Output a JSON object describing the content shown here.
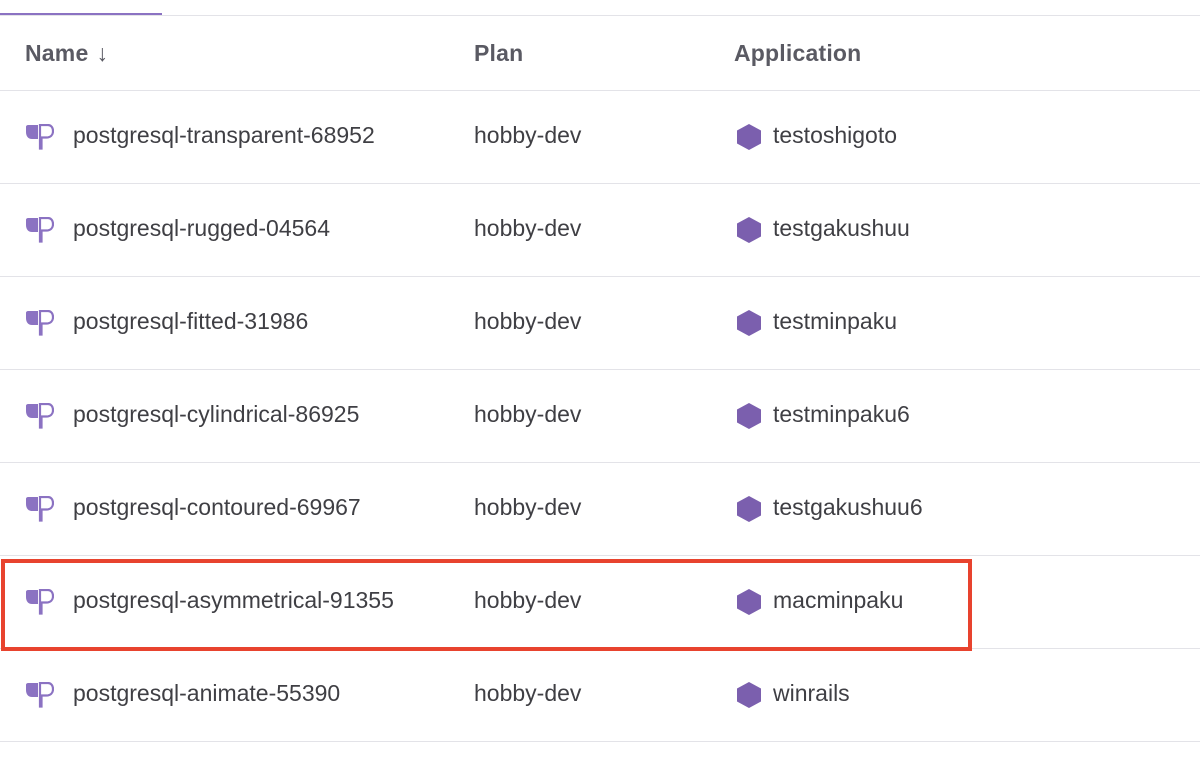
{
  "table": {
    "columns": {
      "name": "Name",
      "name_sort_indicator": "↓",
      "plan": "Plan",
      "application": "Application"
    },
    "rows": [
      {
        "name": "postgresql-transparent-68952",
        "plan": "hobby-dev",
        "application": "testoshigoto"
      },
      {
        "name": "postgresql-rugged-04564",
        "plan": "hobby-dev",
        "application": "testgakushuu"
      },
      {
        "name": "postgresql-fitted-31986",
        "plan": "hobby-dev",
        "application": "testminpaku"
      },
      {
        "name": "postgresql-cylindrical-86925",
        "plan": "hobby-dev",
        "application": "testminpaku6"
      },
      {
        "name": "postgresql-contoured-69967",
        "plan": "hobby-dev",
        "application": "testgakushuu6"
      },
      {
        "name": "postgresql-asymmetrical-91355",
        "plan": "hobby-dev",
        "application": "macminpaku"
      },
      {
        "name": "postgresql-animate-55390",
        "plan": "hobby-dev",
        "application": "winrails"
      }
    ],
    "highlighted_row": "postgresql-asymmetrical-91355"
  },
  "icons": {
    "addon": "postgres-addon-icon",
    "app": "heroku-app-hexagon-icon"
  },
  "colors": {
    "accent": "#8b72c2",
    "app_icon": "#7b5fae",
    "addon_icon": "#8b72c2",
    "highlight": "#e8432e",
    "divider": "#e3e3e8"
  }
}
